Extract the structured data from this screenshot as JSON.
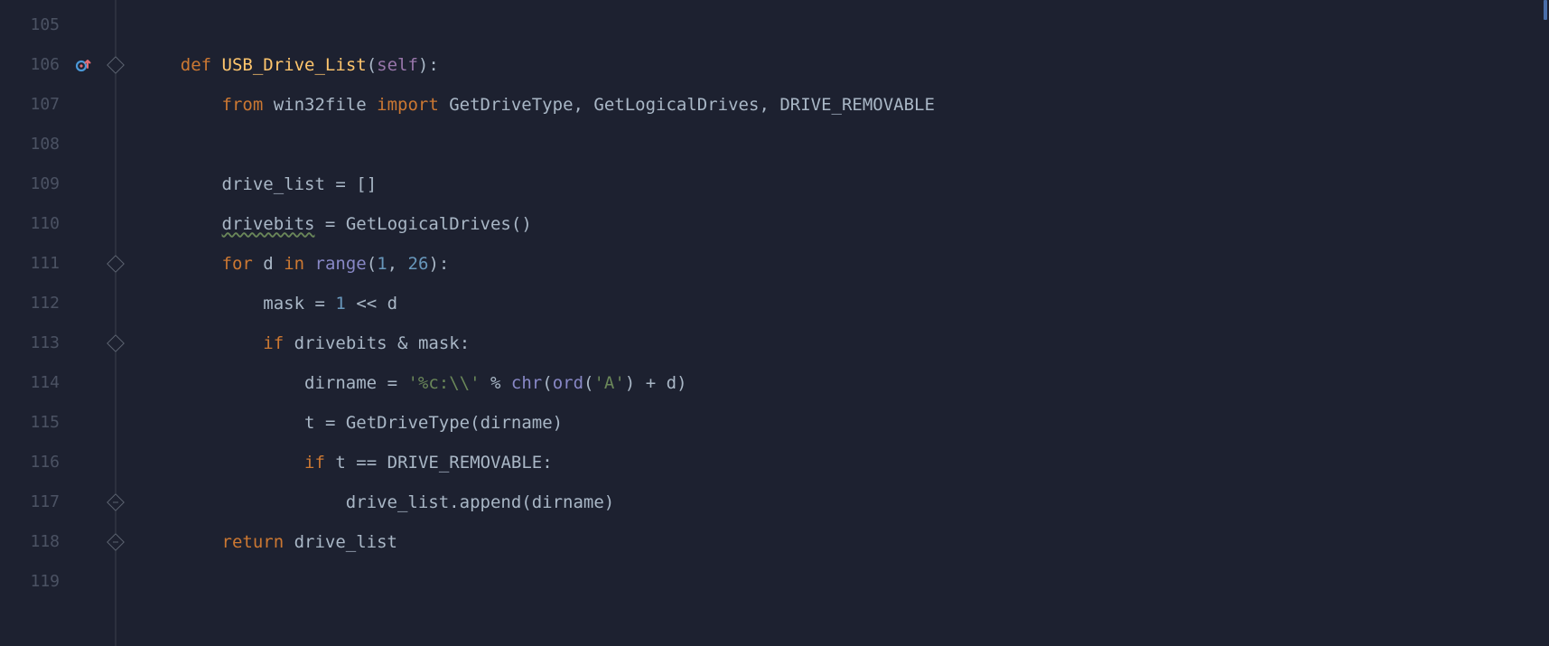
{
  "gutter": {
    "lines": [
      "105",
      "106",
      "107",
      "108",
      "109",
      "110",
      "111",
      "112",
      "113",
      "114",
      "115",
      "116",
      "117",
      "118",
      "119"
    ],
    "badge_line": "106"
  },
  "fold": {
    "markers": {
      "106": "open-down",
      "111": "open-down",
      "113": "open-down",
      "117": "close-up",
      "118": "close-up"
    }
  },
  "code": {
    "l105": "",
    "l106": {
      "indent": "    ",
      "def": "def",
      "sp1": " ",
      "fn": "USB_Drive_List",
      "lp": "(",
      "self": "self",
      "rp": ")",
      "colon": ":"
    },
    "l107": {
      "indent": "        ",
      "from": "from",
      "sp1": " ",
      "mod": "win32file",
      "sp2": " ",
      "import": "import",
      "sp3": " ",
      "n1": "GetDriveType",
      "c1": ", ",
      "n2": "GetLogicalDrives",
      "c2": ", ",
      "n3": "DRIVE_REMOVABLE"
    },
    "l108": "",
    "l109": {
      "indent": "        ",
      "var": "drive_list",
      "sp1": " ",
      "eq": "=",
      "sp2": " ",
      "lb": "[",
      "rb": "]"
    },
    "l110": {
      "indent": "        ",
      "var": "drivebits",
      "sp1": " ",
      "eq": "=",
      "sp2": " ",
      "fn": "GetLogicalDrives",
      "lp": "(",
      "rp": ")"
    },
    "l111": {
      "indent": "        ",
      "for": "for",
      "sp1": " ",
      "var": "d",
      "sp2": " ",
      "in": "in",
      "sp3": " ",
      "range": "range",
      "lp": "(",
      "n1": "1",
      "c": ", ",
      "n2": "26",
      "rp": ")",
      "colon": ":"
    },
    "l112": {
      "indent": "            ",
      "var": "mask",
      "sp1": " ",
      "eq": "=",
      "sp2": " ",
      "n1": "1",
      "sp3": " ",
      "op": "<<",
      "sp4": " ",
      "d": "d"
    },
    "l113": {
      "indent": "            ",
      "if": "if",
      "sp1": " ",
      "a": "drivebits",
      "sp2": " ",
      "amp": "&",
      "sp3": " ",
      "b": "mask",
      "colon": ":"
    },
    "l114": {
      "indent": "                ",
      "var": "dirname",
      "sp1": " ",
      "eq": "=",
      "sp2": " ",
      "str": "'%c:\\\\'",
      "sp3": " ",
      "pct": "%",
      "sp4": " ",
      "chr": "chr",
      "lp1": "(",
      "ord": "ord",
      "lp2": "(",
      "strA": "'A'",
      "rp2": ")",
      "sp5": " ",
      "plus": "+",
      "sp6": " ",
      "d": "d",
      "rp1": ")"
    },
    "l115": {
      "indent": "                ",
      "var": "t",
      "sp1": " ",
      "eq": "=",
      "sp2": " ",
      "fn": "GetDriveType",
      "lp": "(",
      "arg": "dirname",
      "rp": ")"
    },
    "l116": {
      "indent": "                ",
      "if": "if",
      "sp1": " ",
      "a": "t",
      "sp2": " ",
      "eqeq": "==",
      "sp3": " ",
      "b": "DRIVE_REMOVABLE",
      "colon": ":"
    },
    "l117": {
      "indent": "                    ",
      "obj": "drive_list",
      "dot": ".",
      "m": "append",
      "lp": "(",
      "arg": "dirname",
      "rp": ")"
    },
    "l118": {
      "indent": "        ",
      "ret": "return",
      "sp1": " ",
      "var": "drive_list"
    },
    "l119": ""
  },
  "icons": {
    "commit": "commit-arrow-icon"
  },
  "scrollbar": {
    "seg1_top": 0,
    "seg1_h": 22
  }
}
